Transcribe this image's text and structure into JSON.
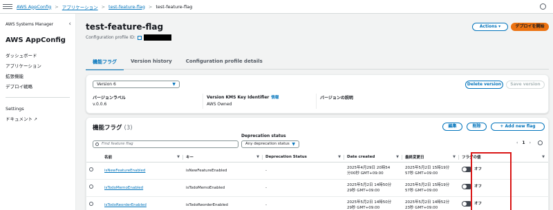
{
  "breadcrumb": {
    "items": [
      "AWS AppConfig",
      "アプリケーション",
      "test-feature-flag",
      "test-feature-flag"
    ],
    "separator": ">"
  },
  "sidebar": {
    "service": "AWS Systems Manager",
    "title": "AWS AppConfig",
    "items": [
      "ダッシュボード",
      "アプリケーション",
      "拡張機能",
      "デプロイ戦略"
    ],
    "footer": [
      "Settings",
      "ドキュメント"
    ]
  },
  "header": {
    "title": "test-feature-flag",
    "config_id_label": "Configuration profile ID:",
    "actions_label": "Actions",
    "deploy_label": "デプロイを開始"
  },
  "tabs": [
    "機能フラグ",
    "Version history",
    "Configuration profile details"
  ],
  "version_card": {
    "selected_version": "Version 6",
    "delete_label": "Delete version",
    "save_label": "Save version",
    "version_label_header": "バージョンラベル",
    "version_label_value": "v.0.0.6",
    "kms_header": "Version KMS Key Identifier",
    "kms_info": "情報",
    "kms_value": "AWS Owned",
    "desc_header": "バージョンの説明"
  },
  "flags": {
    "title": "機能フラグ",
    "count": "(3)",
    "edit_label": "編集",
    "delete_label": "削除",
    "add_label": "+ Add new flag",
    "search_placeholder": "Find feature flag",
    "deprecation_label": "Deprecation status",
    "deprecation_value": "Any deprecation status",
    "page": "1",
    "columns": [
      "名前",
      "キー",
      "Deprecation Status",
      "Date created",
      "最終変更日",
      "フラグの値"
    ],
    "rows": [
      {
        "name": "isNewFeatureEnabled",
        "key": "isNewFeatureEnabled",
        "deprecation": "-",
        "created_1": "2025年4月29日 20時54",
        "created_2": "分00秒 GMT+09:00",
        "modified_1": "2025年5月2日 15時19分",
        "modified_2": "57秒 GMT+09:00",
        "value": "オフ"
      },
      {
        "name": "isTodoMemoEnabled",
        "key": "isTodoMemoEnabled",
        "deprecation": "-",
        "created_1": "2025年5月2日 14時50分",
        "created_2": "29秒 GMT+09:00",
        "modified_1": "2025年5月2日 15時19分",
        "modified_2": "57秒 GMT+09:00",
        "value": "オフ"
      },
      {
        "name": "isTodoReorderEnabled",
        "key": "isTodoReorderEnabled",
        "deprecation": "-",
        "created_1": "2025年5月2日 14時50分",
        "created_2": "29秒 GMT+09:00",
        "modified_1": "2025年5月2日 14時52分",
        "modified_2": "23秒 GMT+09:00",
        "value": "オフ"
      }
    ]
  },
  "colors": {
    "link": "#0073bb",
    "deploy": "#ec7211",
    "highlight": "#d91515"
  }
}
